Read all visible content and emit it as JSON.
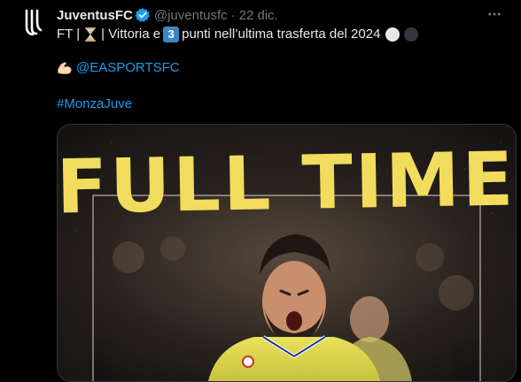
{
  "account": {
    "display_name": "JuventusFC",
    "handle": "@juventusfc",
    "separator": "·",
    "date": "22 dic.",
    "avatar_icon": "juventus-logo-icon",
    "verified_icon": "verified-badge-icon",
    "verified_color": "#1d9bf0"
  },
  "tweet": {
    "line1_prefix": "FT |",
    "line1_hourglass_icon": "hourglass-emoji",
    "line1_mid": "| Vittoria e",
    "line1_keycap": "3",
    "line1_suffix": "punti nell’ultima trasferta del 2024",
    "line1_trailing_icons": [
      "white-circle-emoji",
      "black-circle-emoji"
    ],
    "line2_icon": "flexed-biceps-emoji",
    "mention": "@EASPORTSFC",
    "hashtag": "#MonzaJuve",
    "link_color": "#1d9bf0"
  },
  "media": {
    "headline": "FULL TIME",
    "headline_color": "#f2dc5d",
    "image_subject": "celebrating-player-photo"
  },
  "menu_icon": "more-options-icon"
}
